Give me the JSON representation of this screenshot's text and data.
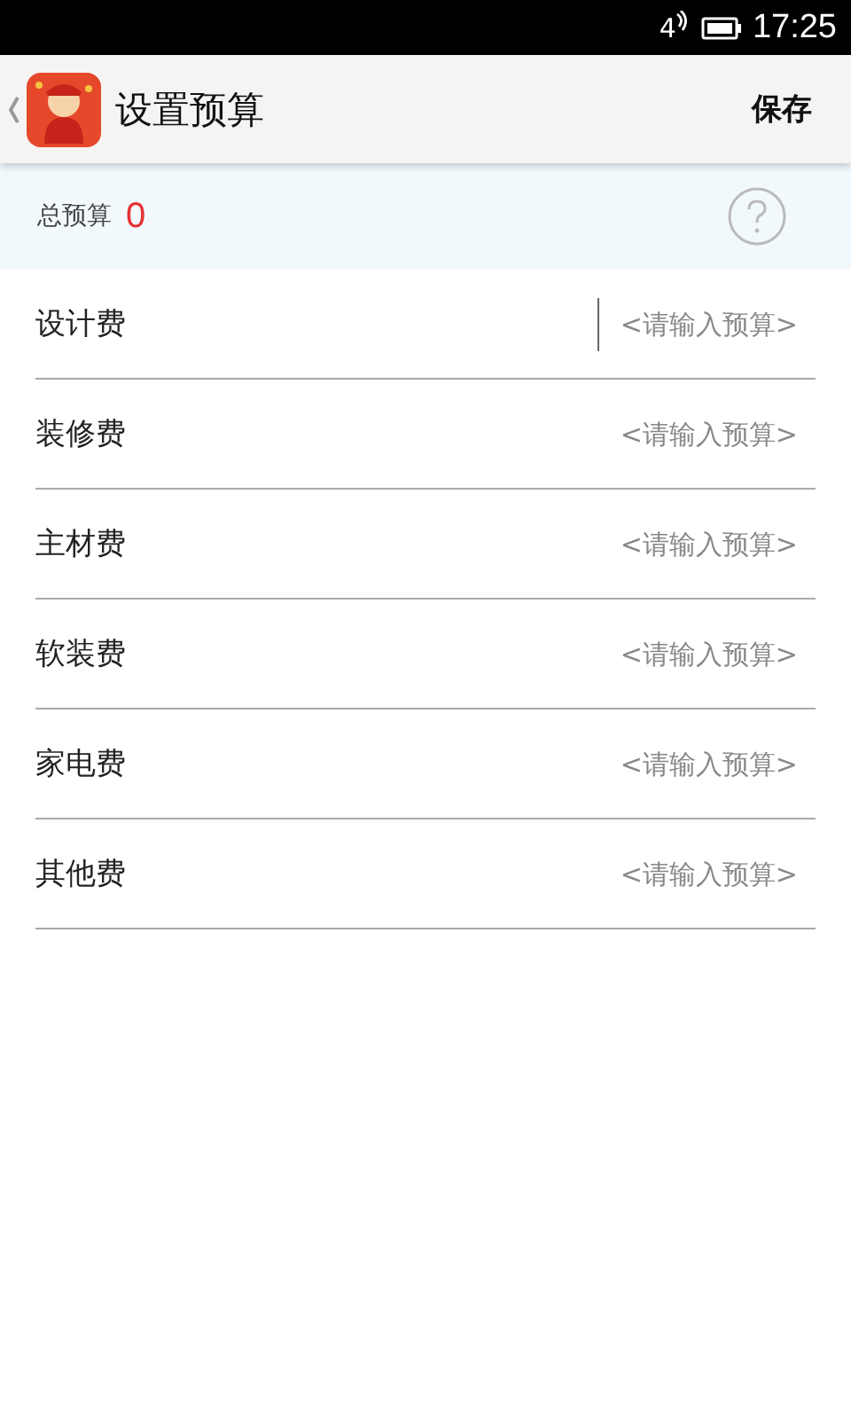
{
  "status_bar": {
    "network": "4",
    "time": "17:25"
  },
  "header": {
    "title": "设置预算",
    "action": "保存"
  },
  "total": {
    "label": "总预算",
    "value": "0"
  },
  "items": [
    {
      "label": "设计费",
      "placeholder": "<请输入预算>",
      "focused": true
    },
    {
      "label": "装修费",
      "placeholder": "<请输入预算>",
      "focused": false
    },
    {
      "label": "主材费",
      "placeholder": "<请输入预算>",
      "focused": false
    },
    {
      "label": "软装费",
      "placeholder": "<请输入预算>",
      "focused": false
    },
    {
      "label": "家电费",
      "placeholder": "<请输入预算>",
      "focused": false
    },
    {
      "label": "其他费",
      "placeholder": "<请输入预算>",
      "focused": false
    }
  ]
}
